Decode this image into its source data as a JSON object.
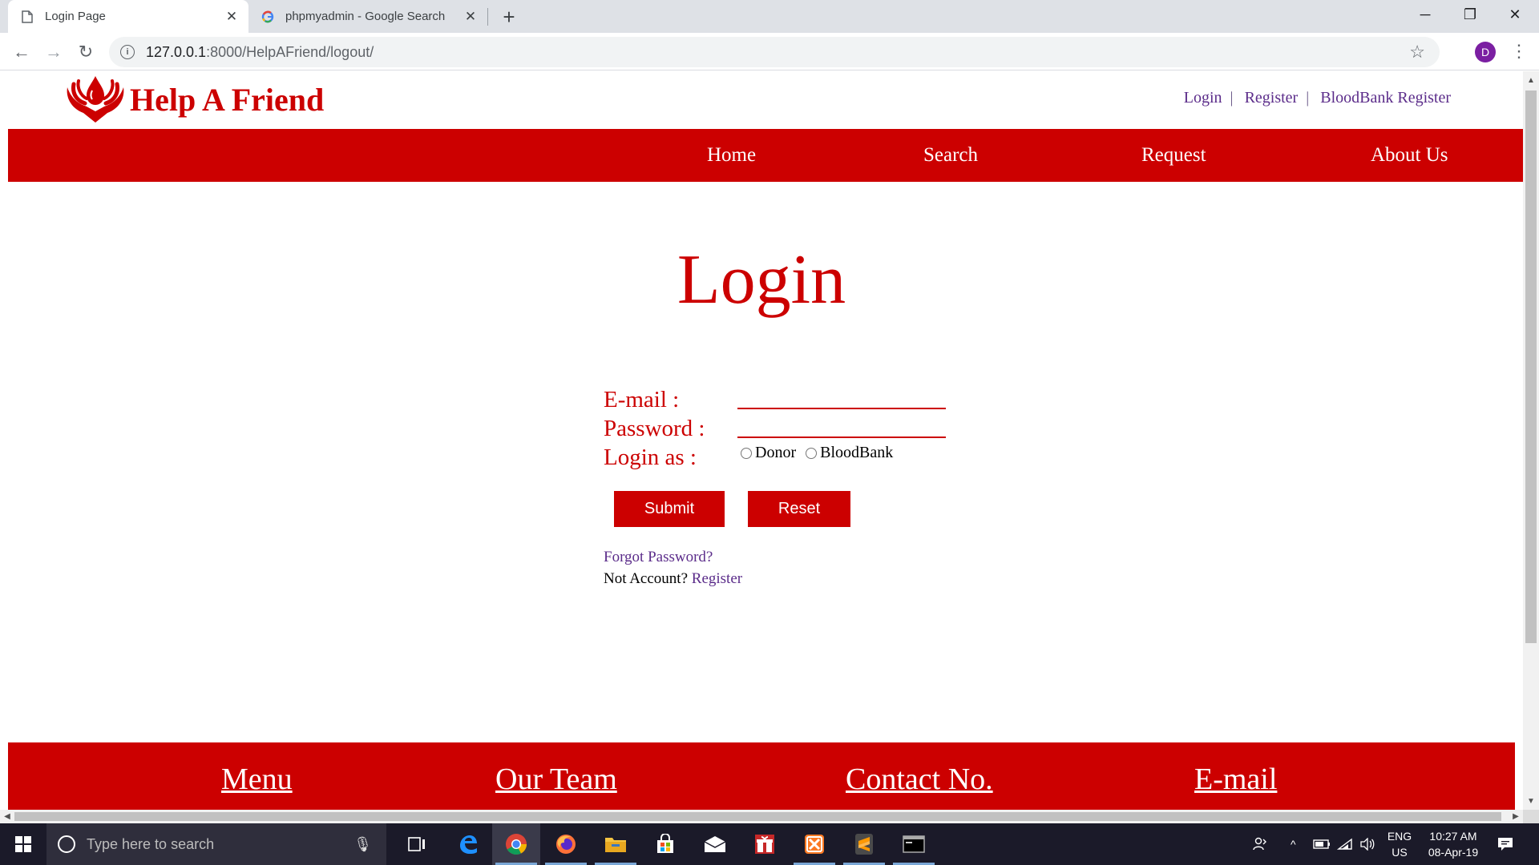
{
  "browser": {
    "tabs": [
      {
        "title": "Login Page",
        "active": true
      },
      {
        "title": "phpmyadmin - Google Search",
        "active": false
      }
    ],
    "url_host": "127.0.0.1",
    "url_path": ":8000/HelpAFriend/logout/",
    "profile_initial": "D"
  },
  "site": {
    "logo_text": "Help A Friend",
    "top_links": {
      "login": "Login",
      "register": "Register",
      "bloodbank_register": "BloodBank Register"
    },
    "nav": {
      "home": "Home",
      "search": "Search",
      "request": "Request",
      "about": "About Us"
    },
    "brand_color": "#cc0000",
    "link_color": "#5b2c8a"
  },
  "login": {
    "title": "Login",
    "email_label": "E-mail :",
    "password_label": "Password :",
    "login_as_label": "Login as :",
    "role_options": {
      "donor": "Donor",
      "bloodbank": "BloodBank"
    },
    "submit_label": "Submit",
    "reset_label": "Reset",
    "forgot_password": "Forgot Password?",
    "no_account_text": "Not Account?",
    "register_link": "Register"
  },
  "footer": {
    "menu": "Menu",
    "team": "Our Team",
    "contact": "Contact No.",
    "email": "E-mail"
  },
  "taskbar": {
    "search_placeholder": "Type here to search",
    "lang_top": "ENG",
    "lang_bottom": "US",
    "time": "10:27 AM",
    "date": "08-Apr-19"
  }
}
